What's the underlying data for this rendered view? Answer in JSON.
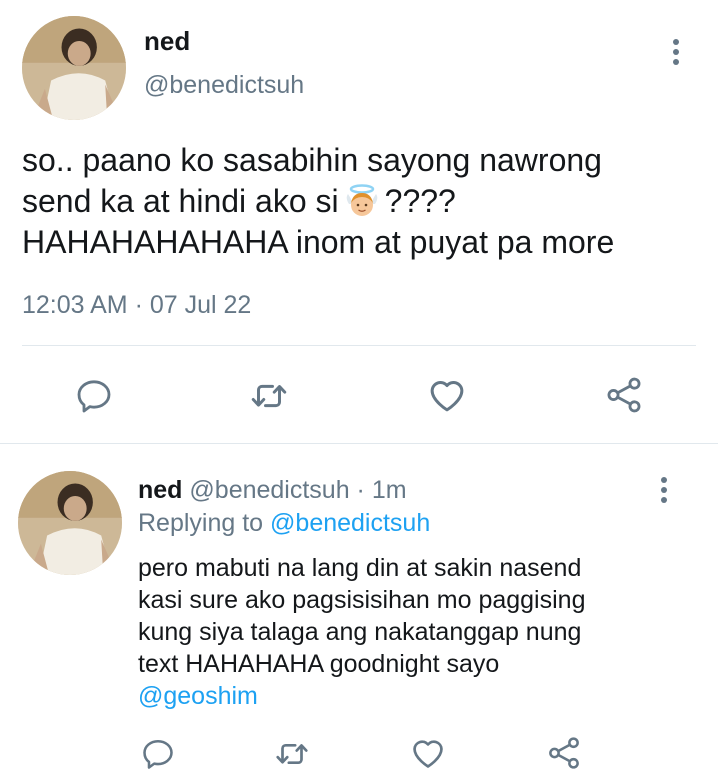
{
  "tweet": {
    "name": "ned",
    "handle": "@benedictsuh",
    "text_lines": [
      "so.. paano ko sasabihin sayong nawrong",
      "send ka at hindi ako si",
      "????",
      "HAHAHAHAHAHA inom at puyat pa more"
    ],
    "timestamp": "12:03 AM · 07 Jul 22"
  },
  "reply": {
    "name": "ned",
    "handle_time": "@benedictsuh · 1m",
    "replying_prefix": "Replying to",
    "replying_to": "@benedictsuh",
    "text_lines": [
      "pero mabuti na lang din at sakin nasend",
      "kasi sure ako pagsisisihan mo paggising",
      "kung siya talaga ang nakatanggap nung",
      "text HAHAHAHA goodnight sayo"
    ],
    "mention": "@geoshim"
  },
  "icons": {
    "reply": "comment-icon",
    "retweet": "retweet-icon",
    "like": "heart-icon",
    "share": "share-icon",
    "more": "more-vertical-icon",
    "emoji": "angel-emoji-icon"
  },
  "colors": {
    "text": "#14171a",
    "secondary": "#657786",
    "link": "#1da1f2",
    "divider": "#e1e8ed"
  }
}
